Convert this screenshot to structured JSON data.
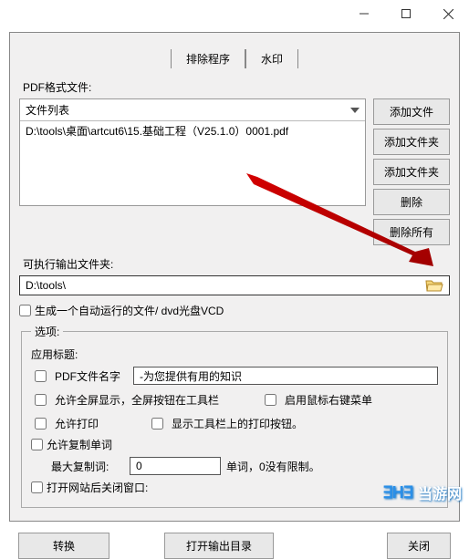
{
  "tabs": {
    "t1": "排除程序",
    "t2": "水印"
  },
  "labels": {
    "pdfFiles": "PDF格式文件:",
    "fileListHdr": "文件列表",
    "outputFolder": "可执行输出文件夹:",
    "options": "选项:",
    "appTitle": "应用标题:",
    "pdfName": "PDF文件名字",
    "fullscreen": "允许全屏显示，全屏按钮在工具栏",
    "rightClick": "启用鼠标右键菜单",
    "allowPrint": "允许打印",
    "showPrintBtn": "显示工具栏上的打印按钮。",
    "allowCopy": "允许复制单词",
    "maxCopy": "最大复制词:",
    "copyUnit": "单词，0没有限制。",
    "closeWindow": "打开网站后关闭窗口:"
  },
  "values": {
    "fileItem": "D:\\tools\\桌面\\artcut6\\15.基础工程（V25.1.0）0001.pdf",
    "outputPath": "D:\\tools\\",
    "autoRun": "生成一个自动运行的文件/ dvd光盘VCD",
    "titleInput": "-为您提供有用的知识",
    "maxCopyVal": "0"
  },
  "buttons": {
    "addFile": "添加文件",
    "addFolder1": "添加文件夹",
    "addFolder2": "添加文件夹",
    "delete": "删除",
    "deleteAll": "删除所有",
    "convert": "转换",
    "openDir": "打开输出目录",
    "close": "关闭"
  },
  "watermark": {
    "logo": "∃H∃",
    "text": "当游网"
  }
}
